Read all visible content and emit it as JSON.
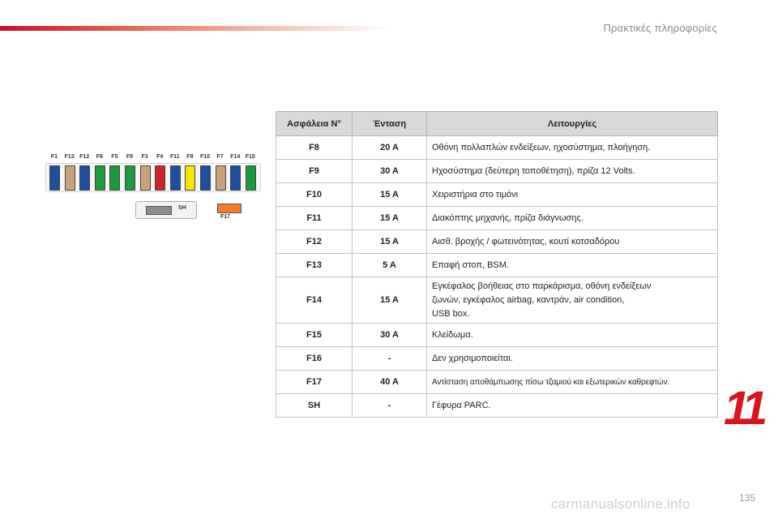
{
  "header": {
    "section_title": "Πρακτικές πληροφορίες"
  },
  "chapter_number": "11",
  "page_number": "135",
  "watermark": "carmanualsonline.info",
  "colors": {
    "accent": "#d9141f"
  },
  "diagram": {
    "fuses": [
      {
        "label": "F1",
        "color": "#1f4fa0"
      },
      {
        "label": "F13",
        "color": "#c9a27a"
      },
      {
        "label": "F12",
        "color": "#1f4fa0"
      },
      {
        "label": "F6",
        "color": "#1c9a3e"
      },
      {
        "label": "F5",
        "color": "#1c9a3e"
      },
      {
        "label": "F9",
        "color": "#1c9a3e"
      },
      {
        "label": "F3",
        "color": "#c9a27a"
      },
      {
        "label": "F4",
        "color": "#d0222e"
      },
      {
        "label": "F11",
        "color": "#1f4fa0"
      },
      {
        "label": "F8",
        "color": "#f5e600"
      },
      {
        "label": "F10",
        "color": "#1f4fa0"
      },
      {
        "label": "F7",
        "color": "#c9a27a"
      },
      {
        "label": "F14",
        "color": "#1f4fa0"
      },
      {
        "label": "F15",
        "color": "#1c9a3e"
      }
    ],
    "sh_label": "SH",
    "f17_label": "F17"
  },
  "table": {
    "headers": {
      "fuse": "Ασφάλεια N°",
      "rating": "Ένταση",
      "function": "Λειτουργίες"
    },
    "rows": [
      {
        "fuse": "F8",
        "rating": "20 A",
        "function": "Οθόνη πολλαπλών ενδείξεων, ηχοσύστημα, πλοήγηση."
      },
      {
        "fuse": "F9",
        "rating": "30 A",
        "function": "Ηχοσύστημα (δεύτερη τοποθέτηση), πρίζα 12 Volts."
      },
      {
        "fuse": "F10",
        "rating": "15 A",
        "function": "Χειριστήρια στο τιμόνι"
      },
      {
        "fuse": "F11",
        "rating": "15 A",
        "function": "Διακόπτης μηχανής, πρίζα διάγνωσης."
      },
      {
        "fuse": "F12",
        "rating": "15 A",
        "function": "Αισθ. βροχής / φωτεινότητας, κουτί κοτσαδόρου"
      },
      {
        "fuse": "F13",
        "rating": "5 A",
        "function": "Επαφή στοπ, BSM."
      },
      {
        "fuse": "F14",
        "rating": "15 A",
        "function_lines": [
          "Εγκέφαλος βοήθειας στο παρκάρισμα, οθόνη ενδείξεων",
          "ζωνών, εγκέφαλος airbag, καντράν, air condition,",
          "USB box."
        ]
      },
      {
        "fuse": "F15",
        "rating": "30 A",
        "function": "Κλείδωμα."
      },
      {
        "fuse": "F16",
        "rating": "-",
        "function": "Δεν χρησιμοποιείται."
      },
      {
        "fuse": "F17",
        "rating": "40 A",
        "function": "Αντίσταση αποθάμπωσης πίσω τζαμιού και εξωτερικών καθρεφτών."
      },
      {
        "fuse": "SH",
        "rating": "-",
        "function": "Γέφυρα PARC."
      }
    ]
  }
}
